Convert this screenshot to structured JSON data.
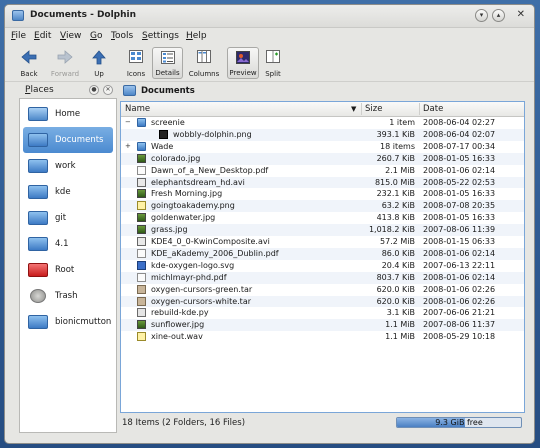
{
  "window": {
    "title": "Documents - Dolphin"
  },
  "menu": [
    {
      "key": "F",
      "rest": "ile"
    },
    {
      "key": "E",
      "rest": "dit"
    },
    {
      "key": "V",
      "rest": "iew"
    },
    {
      "key": "G",
      "rest": "o"
    },
    {
      "key": "T",
      "rest": "ools"
    },
    {
      "key": "S",
      "rest": "ettings"
    },
    {
      "key": "H",
      "rest": "elp"
    }
  ],
  "toolbar": {
    "back": "Back",
    "forward": "Forward",
    "up": "Up",
    "icons": "Icons",
    "details": "Details",
    "columns": "Columns",
    "preview": "Preview",
    "split": "Split"
  },
  "places": {
    "title_key": "P",
    "title_rest": "laces",
    "items": [
      {
        "label": "Home"
      },
      {
        "label": "Documents"
      },
      {
        "label": "work"
      },
      {
        "label": "kde"
      },
      {
        "label": "git"
      },
      {
        "label": "4.1"
      },
      {
        "label": "Root"
      },
      {
        "label": "Trash"
      },
      {
        "label": "bionicmutton"
      }
    ]
  },
  "location": {
    "label": "Documents"
  },
  "columns": {
    "name": "Name",
    "size": "Size",
    "date": "Date"
  },
  "files": [
    {
      "name": "screenie",
      "size": "1 item",
      "date": "2008-06-04 02:27",
      "type": "folder",
      "expander": "−",
      "indent": 0
    },
    {
      "name": "wobbly-dolphin.png",
      "size": "393.1 KiB",
      "date": "2008-06-04 02:07",
      "type": "dark",
      "expander": "",
      "indent": 1
    },
    {
      "name": "Wade",
      "size": "18 items",
      "date": "2008-07-17 00:34",
      "type": "folder",
      "expander": "+",
      "indent": 0
    },
    {
      "name": "colorado.jpg",
      "size": "260.7 KiB",
      "date": "2008-01-05 16:33",
      "type": "img",
      "expander": "",
      "indent": 0
    },
    {
      "name": "Dawn_of_a_New_Desktop.pdf",
      "size": "2.1 MiB",
      "date": "2008-01-06 02:14",
      "type": "doc",
      "expander": "",
      "indent": 0
    },
    {
      "name": "elephantsdream_hd.avi",
      "size": "815.0 MiB",
      "date": "2008-05-22 02:53",
      "type": "video",
      "expander": "",
      "indent": 0
    },
    {
      "name": "Fresh Morning.jpg",
      "size": "232.1 KiB",
      "date": "2008-01-05 16:33",
      "type": "img",
      "expander": "",
      "indent": 0
    },
    {
      "name": "goingtoakademy.png",
      "size": "63.2 KiB",
      "date": "2008-07-08 20:35",
      "type": "wav",
      "expander": "",
      "indent": 0
    },
    {
      "name": "goldenwater.jpg",
      "size": "413.8 KiB",
      "date": "2008-01-05 16:33",
      "type": "img",
      "expander": "",
      "indent": 0
    },
    {
      "name": "grass.jpg",
      "size": "1,018.2 KiB",
      "date": "2007-08-06 11:39",
      "type": "img",
      "expander": "",
      "indent": 0
    },
    {
      "name": "KDE4_0_0-KwinComposite.avi",
      "size": "57.2 MiB",
      "date": "2008-01-15 06:33",
      "type": "video",
      "expander": "",
      "indent": 0
    },
    {
      "name": "KDE_aKademy_2006_Dublin.pdf",
      "size": "86.0 KiB",
      "date": "2008-01-06 02:14",
      "type": "doc",
      "expander": "",
      "indent": 0
    },
    {
      "name": "kde-oxygen-logo.svg",
      "size": "20.4 KiB",
      "date": "2007-06-13 22:11",
      "type": "svg",
      "expander": "",
      "indent": 0
    },
    {
      "name": "michlmayr-phd.pdf",
      "size": "803.7 KiB",
      "date": "2008-01-06 02:14",
      "type": "doc",
      "expander": "",
      "indent": 0
    },
    {
      "name": "oxygen-cursors-green.tar",
      "size": "620.0 KiB",
      "date": "2008-01-06 02:26",
      "type": "tar",
      "expander": "",
      "indent": 0
    },
    {
      "name": "oxygen-cursors-white.tar",
      "size": "620.0 KiB",
      "date": "2008-01-06 02:26",
      "type": "tar",
      "expander": "",
      "indent": 0
    },
    {
      "name": "rebuild-kde.py",
      "size": "3.1 KiB",
      "date": "2007-06-06 21:21",
      "type": "py",
      "expander": "",
      "indent": 0
    },
    {
      "name": "sunflower.jpg",
      "size": "1.1 MiB",
      "date": "2007-08-06 11:37",
      "type": "img",
      "expander": "",
      "indent": 0
    },
    {
      "name": "xine-out.wav",
      "size": "1.1 MiB",
      "date": "2008-05-29 10:18",
      "type": "wav",
      "expander": "",
      "indent": 0
    }
  ],
  "status": {
    "text": "18 Items (2 Folders, 16 Files)",
    "free": "9.3 GiB free",
    "used_fraction": 0.55
  },
  "colors": {
    "accent": "#4b8ad0",
    "selection_alt_row": "#f0f4fa",
    "root_folder": "#c81c1c"
  },
  "icons": {
    "back": "arrow-left-icon",
    "forward": "arrow-right-icon",
    "up": "arrow-up-icon",
    "icons": "icons-view-icon",
    "details": "details-view-icon",
    "columns": "columns-view-icon",
    "preview": "preview-icon",
    "split": "split-icon"
  }
}
